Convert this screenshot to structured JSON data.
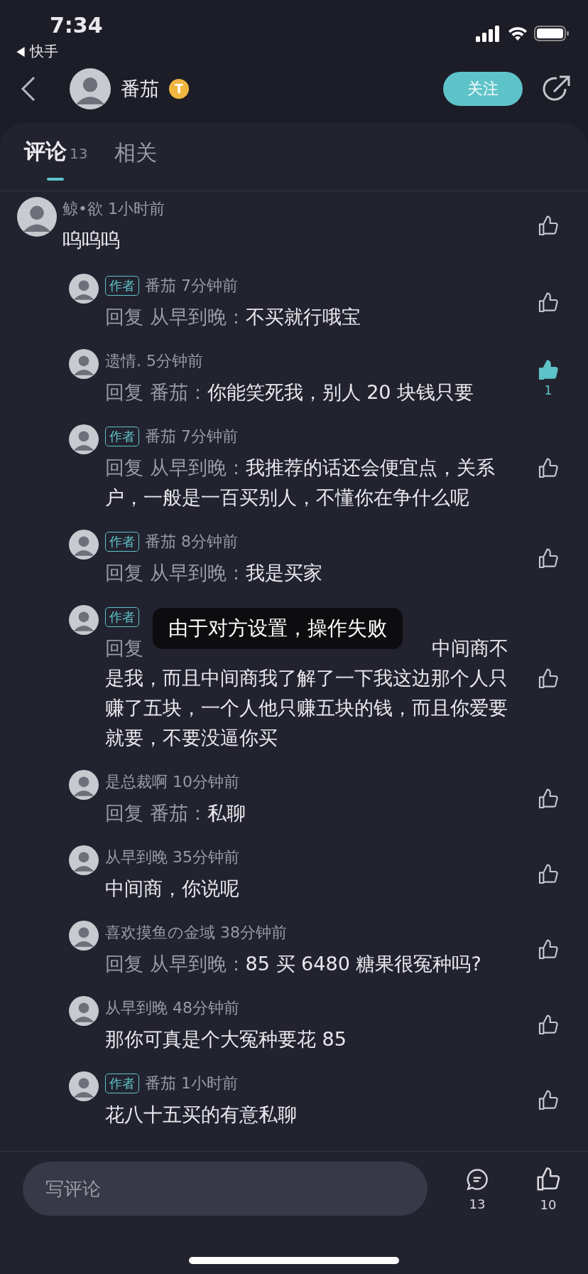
{
  "status_bar": {
    "time": "7:34",
    "back_app": "快手"
  },
  "header": {
    "name": "番茄",
    "badge_letter": "T",
    "follow_button": "关注"
  },
  "tabs": [
    {
      "label": "评论",
      "count": "13",
      "selected": true
    },
    {
      "label": "相关",
      "selected": false
    }
  ],
  "comments": [
    {
      "author": "鲸•欲",
      "time": "1小时前",
      "text": "呜呜呜",
      "liked": false,
      "children": [
        {
          "kind": "reply",
          "author": "番茄",
          "badge": "作者",
          "time": "7分钟前",
          "reply_label": "回复",
          "reply_to": "从早到晚：",
          "text": "不买就行哦宝",
          "liked": false
        },
        {
          "kind": "reply",
          "author": "遗情.",
          "time": "5分钟前",
          "reply_label": "回复",
          "reply_to": "番茄：",
          "text": "你能笑死我，别人 20 块钱只要",
          "liked": true,
          "like_count": "1"
        },
        {
          "kind": "reply",
          "author": "番茄",
          "badge": "作者",
          "time": "7分钟前",
          "reply_label": "回复",
          "reply_to": "从早到晚：",
          "text": "我推荐的话还会便宜点，关系户，一般是一百买别人，不懂你在争什么呢",
          "liked": false
        },
        {
          "kind": "reply",
          "author": "番茄",
          "badge": "作者",
          "time": "8分钟前",
          "reply_label": "回复",
          "reply_to": "从早到晚：",
          "text": "我是买家",
          "liked": false
        },
        {
          "kind": "obscured",
          "badge": "作者",
          "reply_label": "回复",
          "text_first_line": "中间商不",
          "text": "是我，而且中间商我了解了一下我这边那个人只赚了五块，一个人他只赚五块的钱，而且你爱要就要，不要没逼你买",
          "liked": false
        },
        {
          "kind": "reply",
          "author": "是总裁啊",
          "time": "10分钟前",
          "reply_label": "回复",
          "reply_to": "番茄：",
          "text": "私聊",
          "liked": false
        },
        {
          "kind": "reply",
          "author": "从早到晚",
          "time": "35分钟前",
          "text": "中间商，你说呢",
          "liked": false
        },
        {
          "kind": "reply",
          "author": "喜欢摸鱼の金域",
          "time": "38分钟前",
          "reply_label": "回复",
          "reply_to": "从早到晚：",
          "text": "85 买 6480 糖果很冤种吗?",
          "liked": false
        },
        {
          "kind": "reply",
          "author": "从早到晚",
          "time": "48分钟前",
          "text": "那你可真是个大冤种要花 85",
          "liked": false
        },
        {
          "kind": "reply",
          "author": "番茄",
          "badge": "作者",
          "time": "1小时前",
          "text": "花八十五买的有意私聊",
          "liked": false
        }
      ]
    }
  ],
  "toast": "由于对方设置，操作失败",
  "footer": {
    "placeholder": "写评论",
    "comment_count": "13",
    "like_count": "10"
  }
}
